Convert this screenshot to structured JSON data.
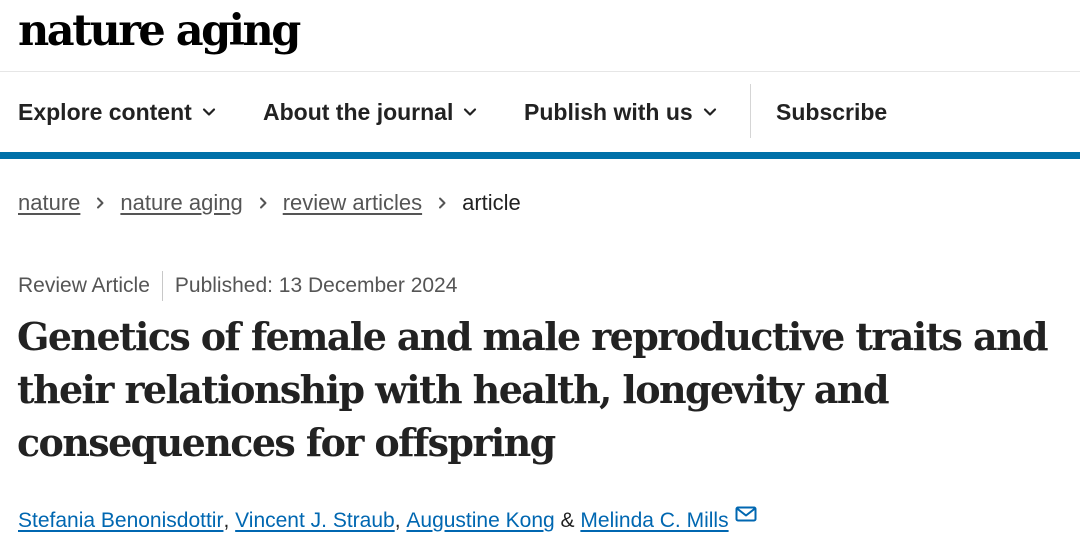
{
  "site": {
    "logo": "nature aging"
  },
  "nav": {
    "items": [
      {
        "label": "Explore content",
        "icon": "chevron-down-icon"
      },
      {
        "label": "About the journal",
        "icon": "chevron-down-icon"
      },
      {
        "label": "Publish with us",
        "icon": "chevron-down-icon"
      }
    ],
    "subscribe_label": "Subscribe"
  },
  "breadcrumb": {
    "items": [
      "nature",
      "nature aging",
      "review articles"
    ],
    "current": "article",
    "separator_icon": "chevron-right-icon"
  },
  "article": {
    "type": "Review Article",
    "published": "Published: 13 December 2024",
    "title_lines": [
      "Genetics of female and male reproductive traits and",
      "their relationship with health, longevity and",
      "consequences for offspring"
    ],
    "authors": [
      "Stefania Benonisdottir",
      "Vincent J. Straub",
      "Augustine Kong",
      "Melinda C. Mills"
    ],
    "author_separator": ",",
    "author_conjunction": "&",
    "contact_icon": "email-icon"
  },
  "colors": {
    "accent": "#0070a8",
    "link": "#0067b1",
    "text": "#222222",
    "muted": "#555555"
  }
}
